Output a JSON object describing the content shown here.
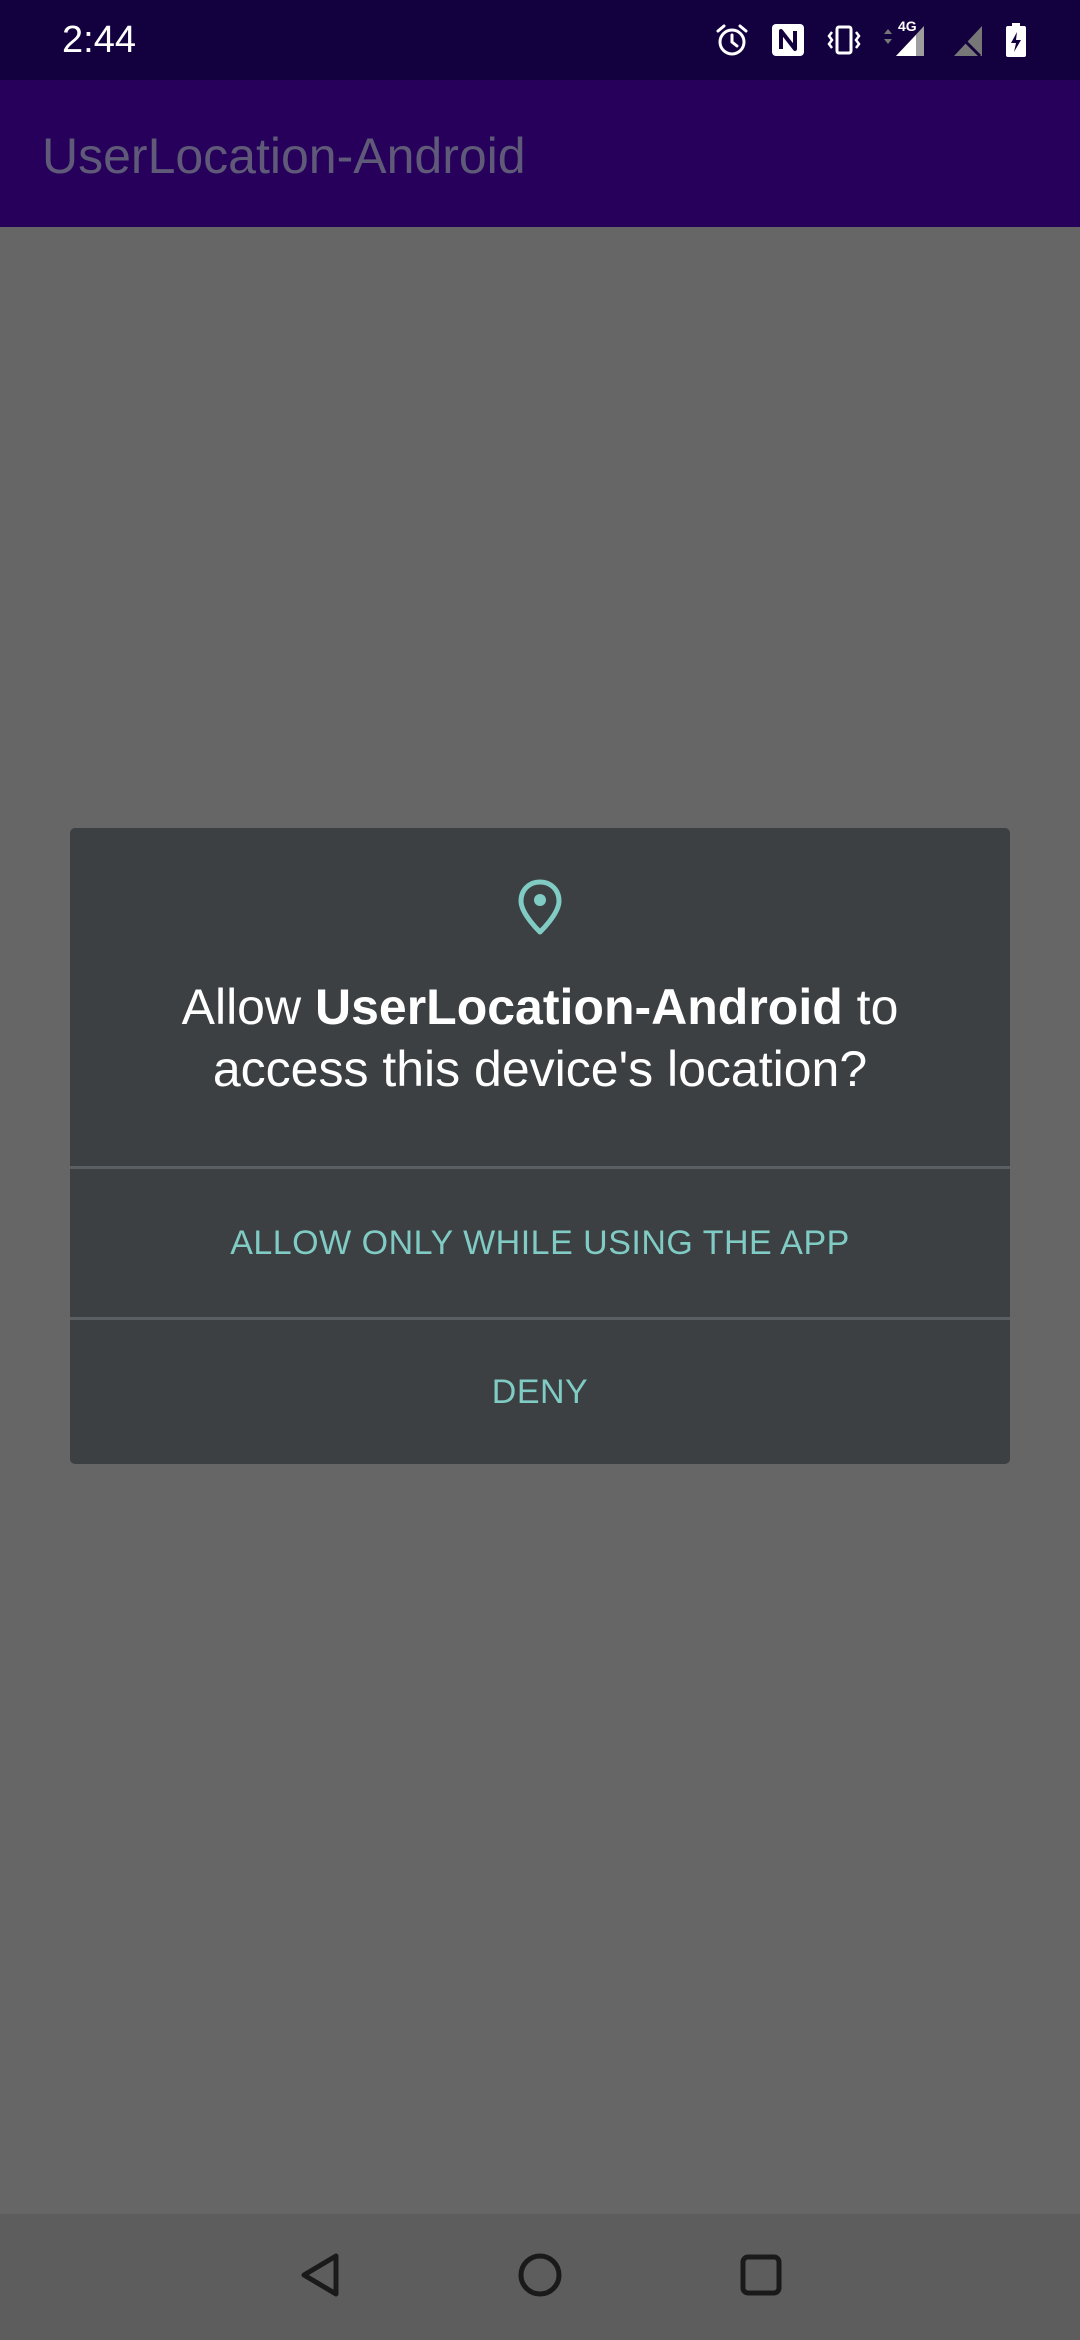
{
  "status_bar": {
    "time": "2:44",
    "icons": [
      "alarm-icon",
      "nfc-icon",
      "vibrate-icon",
      "signal-4g-icon",
      "no-sim-icon",
      "battery-icon"
    ],
    "network_label": "4G"
  },
  "app_bar": {
    "title": "UserLocation-Android"
  },
  "dialog": {
    "icon": "location-pin-icon",
    "message_prefix": "Allow ",
    "message_app": "UserLocation-Android",
    "message_suffix": " to access this device's location?",
    "buttons": {
      "allow_while_using": "ALLOW ONLY WHILE USING THE APP",
      "deny": "DENY"
    }
  },
  "nav_bar": {
    "buttons": [
      "back-icon",
      "home-icon",
      "recents-icon"
    ]
  },
  "colors": {
    "status_bar_bg": "#13003f",
    "app_bar_bg": "#27005c",
    "scrim_bg": "#666666",
    "dialog_bg": "#3c4043",
    "accent": "#80cbc4"
  }
}
